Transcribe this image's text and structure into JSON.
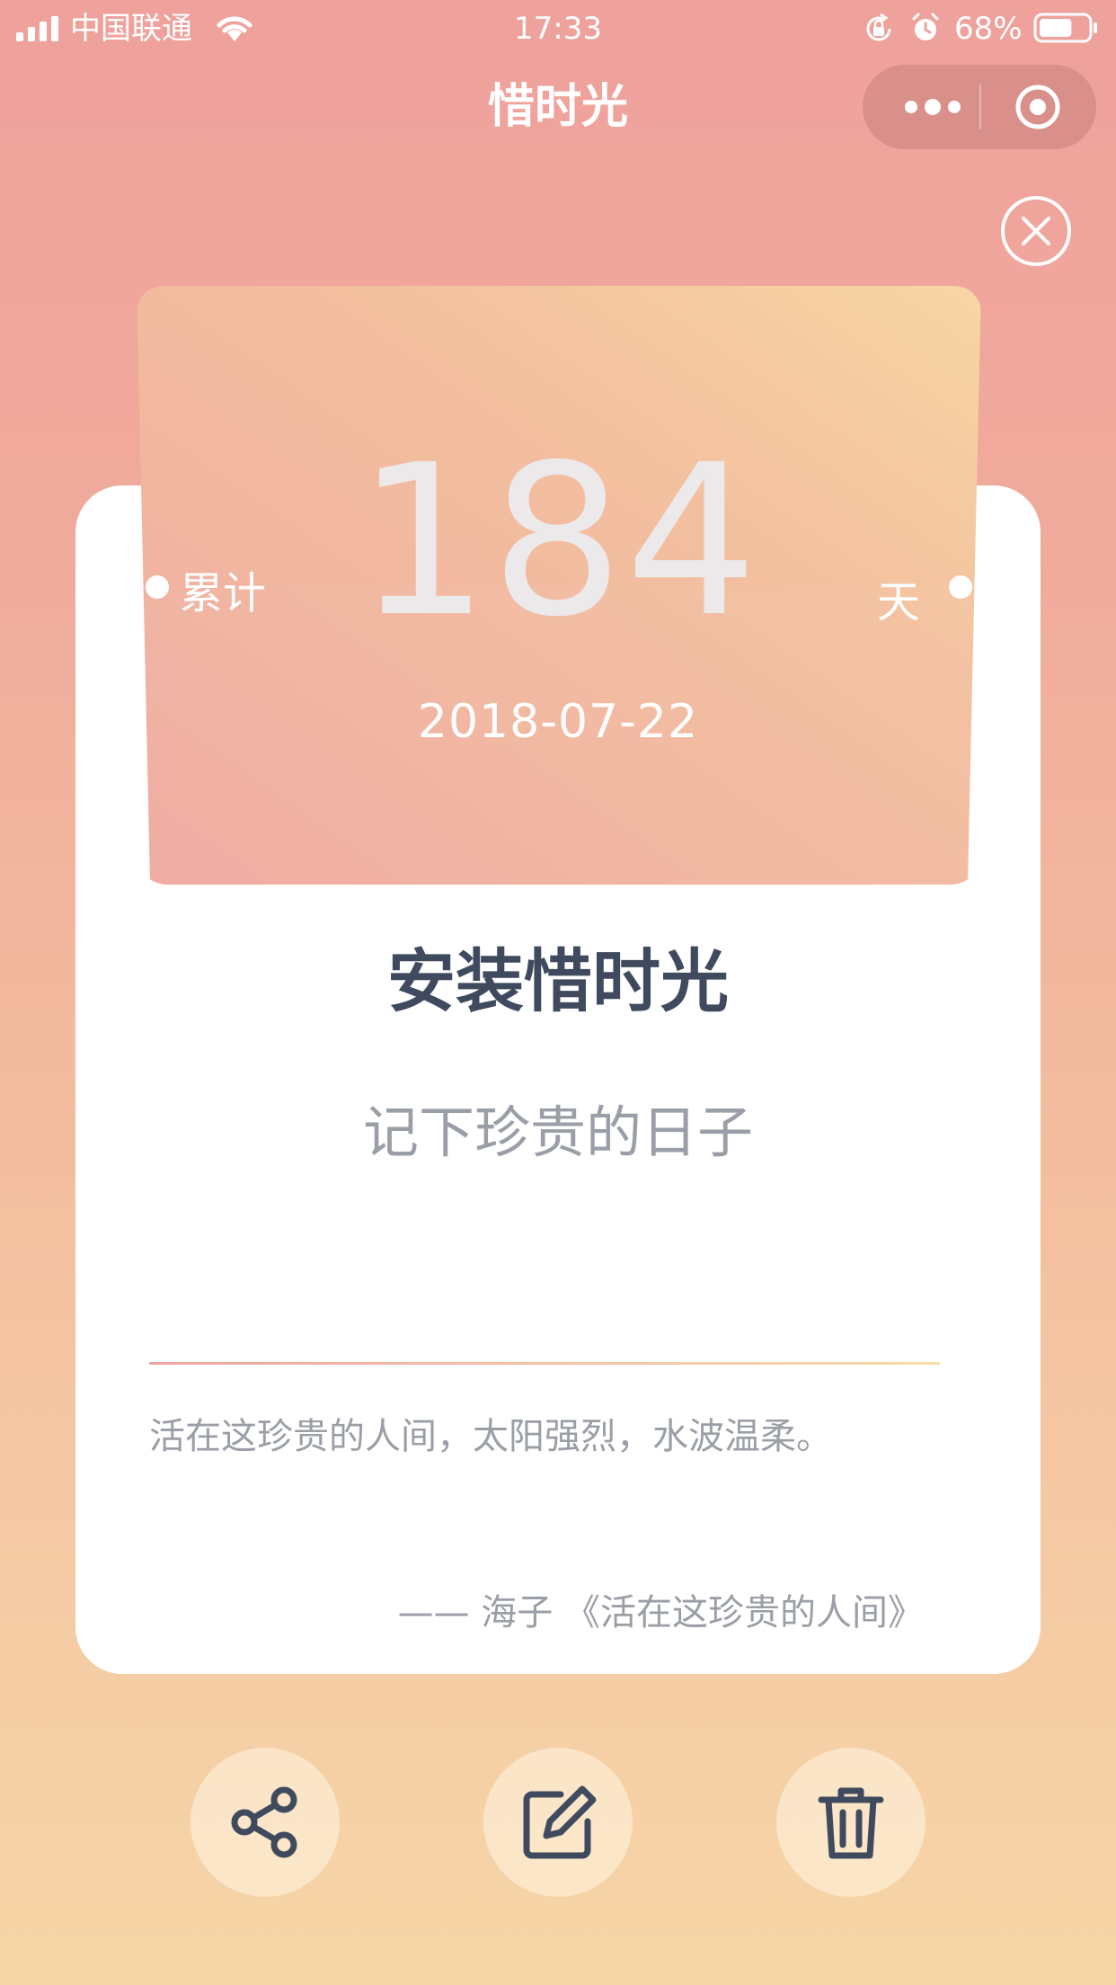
{
  "status_bar": {
    "carrier": "中国联通",
    "time": "17:33",
    "battery_percent": "68%",
    "battery_level": 0.68,
    "icons": [
      "signal-icon",
      "wifi-icon",
      "rotation-lock-icon",
      "alarm-icon",
      "battery-icon"
    ]
  },
  "nav": {
    "title": "惜时光",
    "capsule_icons": [
      "more-icon",
      "target-icon"
    ]
  },
  "counter": {
    "prefix": "累计",
    "days": "184",
    "suffix": "天",
    "date": "2018-07-22"
  },
  "event": {
    "title": "安装惜时光",
    "subtitle": "记下珍贵的日子"
  },
  "quote": {
    "text": "活在这珍贵的人间，太阳强烈，水波温柔。",
    "source": "—— 海子 《活在这珍贵的人间》"
  },
  "actions": [
    {
      "icon": "share-icon"
    },
    {
      "icon": "edit-icon"
    },
    {
      "icon": "trash-icon"
    }
  ],
  "colors": {
    "bg_top": "#efa19c",
    "bg_bottom": "#f6d6a7",
    "title_text": "#404a5e",
    "muted_text": "#9a9ea6",
    "icon": "#404a5e"
  }
}
